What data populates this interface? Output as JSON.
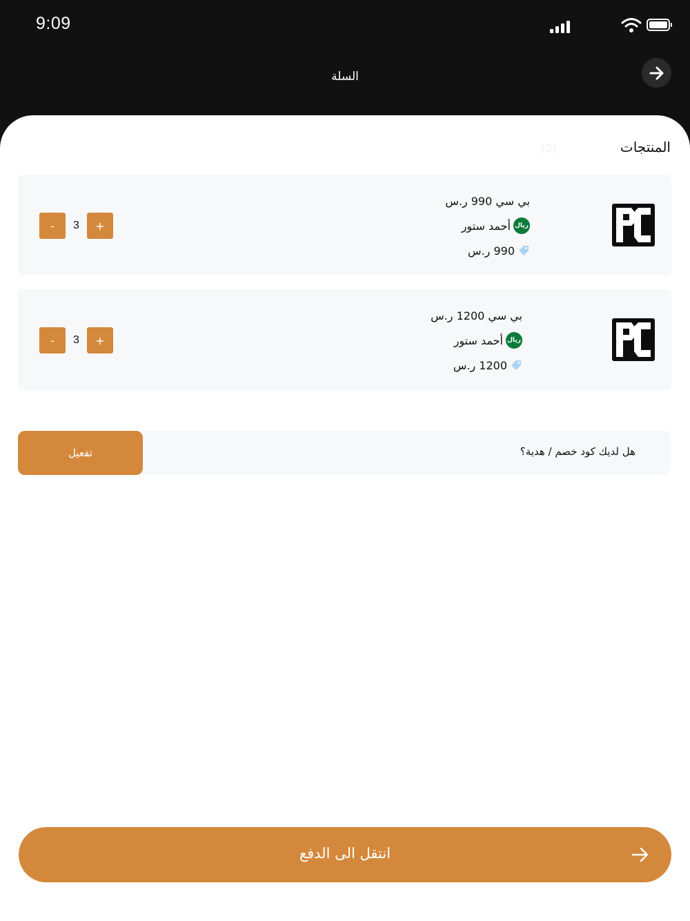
{
  "status_bar": {
    "time": "9:09"
  },
  "header": {
    "title": "السلة"
  },
  "products_section": {
    "title": "المنتجات",
    "count": "(2)"
  },
  "products": [
    {
      "name": "بي سي 990 ر.س",
      "store": "أحمد ستور",
      "price": "990 ر.س",
      "quantity": "3",
      "increment_label": "+",
      "decrement_label": "-",
      "store_badge": "ريال"
    },
    {
      "name": "بي سي 1200 ر.س",
      "store": "أحمد ستور",
      "price": "1200 ر.س",
      "quantity": "3",
      "increment_label": "+",
      "decrement_label": "-",
      "store_badge": "ريال"
    }
  ],
  "coupon": {
    "prompt": "هل لديك كود خصم / هدية؟",
    "activate_label": "تفعيل"
  },
  "checkout": {
    "label": "انتقل الى الدفع"
  },
  "colors": {
    "accent": "#d4883b",
    "header_bg": "#111111",
    "card_bg": "#f7f8fa",
    "store_badge": "#0c7a3a"
  },
  "icons": {
    "back": "arrow-right-icon",
    "checkout": "arrow-right-icon",
    "price": "tag-icon",
    "product": "pc-logo-icon",
    "store": "store-badge-icon"
  }
}
